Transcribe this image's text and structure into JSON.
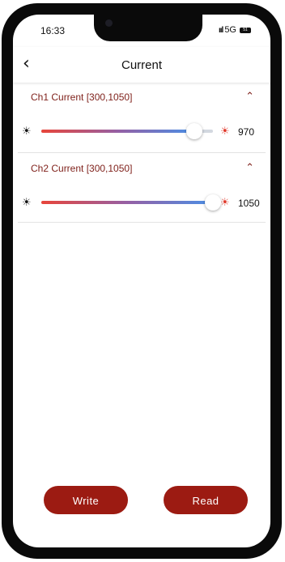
{
  "status_bar": {
    "time": "16:33",
    "network": "5G",
    "signal": "ııl",
    "battery": "51"
  },
  "header": {
    "back_icon": "‹",
    "title": "Current"
  },
  "channels": [
    {
      "label": "Ch1 Current [300,1050]",
      "min": 300,
      "max": 1050,
      "value": "970",
      "slider_value": 970,
      "expanded": true
    },
    {
      "label": "Ch2 Current [300,1050]",
      "min": 300,
      "max": 1050,
      "value": "1050",
      "slider_value": 1050,
      "expanded": true
    }
  ],
  "icons": {
    "brightness_low": "sun-icon",
    "brightness_high": "sun-icon-red",
    "chevron": "chevron-up-icon"
  },
  "buttons": {
    "write_label": "Write",
    "read_label": "Read"
  },
  "colors": {
    "accent": "#9c1b12",
    "label": "#7e1f19",
    "slider_start": "#e8453a",
    "slider_end": "#4a8fe6"
  }
}
